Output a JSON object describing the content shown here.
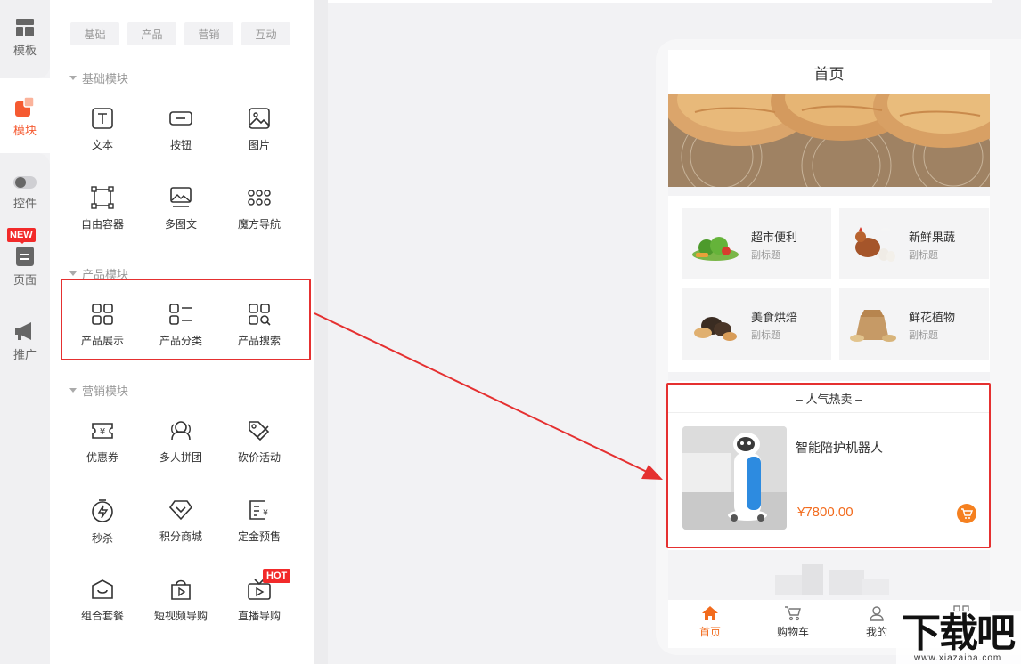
{
  "rail": {
    "items": [
      {
        "label": "模板",
        "icon": "template-icon"
      },
      {
        "label": "模块",
        "icon": "module-icon"
      },
      {
        "label": "控件",
        "icon": "toggle-icon"
      },
      {
        "label": "页面",
        "icon": "page-icon"
      },
      {
        "label": "推广",
        "icon": "megaphone-icon"
      }
    ],
    "new_badge": "NEW"
  },
  "panel": {
    "tabs": [
      "基础",
      "产品",
      "营销",
      "互动"
    ],
    "sections": [
      {
        "title": "基础模块",
        "items": [
          "文本",
          "按钮",
          "图片",
          "自由容器",
          "多图文",
          "魔方导航"
        ]
      },
      {
        "title": "产品模块",
        "items": [
          "产品展示",
          "产品分类",
          "产品搜索"
        ]
      },
      {
        "title": "营销模块",
        "items": [
          "优惠券",
          "多人拼团",
          "砍价活动",
          "秒杀",
          "积分商城",
          "定金预售",
          "组合套餐",
          "短视频导购",
          "直播导购"
        ]
      }
    ],
    "hot_badge": "HOT"
  },
  "phone": {
    "page_title": "首页",
    "categories": [
      {
        "title": "超市便利",
        "subtitle": "副标题"
      },
      {
        "title": "新鲜果蔬",
        "subtitle": "副标题"
      },
      {
        "title": "美食烘焙",
        "subtitle": "副标题"
      },
      {
        "title": "鲜花植物",
        "subtitle": "副标题"
      }
    ],
    "hot_section": {
      "title": "– 人气热卖 –",
      "product_name": "智能陪护机器人",
      "price": "¥7800.00"
    },
    "tabbar": [
      {
        "label": "首页",
        "icon": "home-icon"
      },
      {
        "label": "购物车",
        "icon": "cart-icon"
      },
      {
        "label": "我的",
        "icon": "user-icon"
      }
    ]
  },
  "watermark": {
    "text": "下载吧",
    "url": "www.xiazaiba.com"
  },
  "colors": {
    "accent": "#f55a31",
    "price": "#f26b1d",
    "annotation": "#e53030"
  }
}
